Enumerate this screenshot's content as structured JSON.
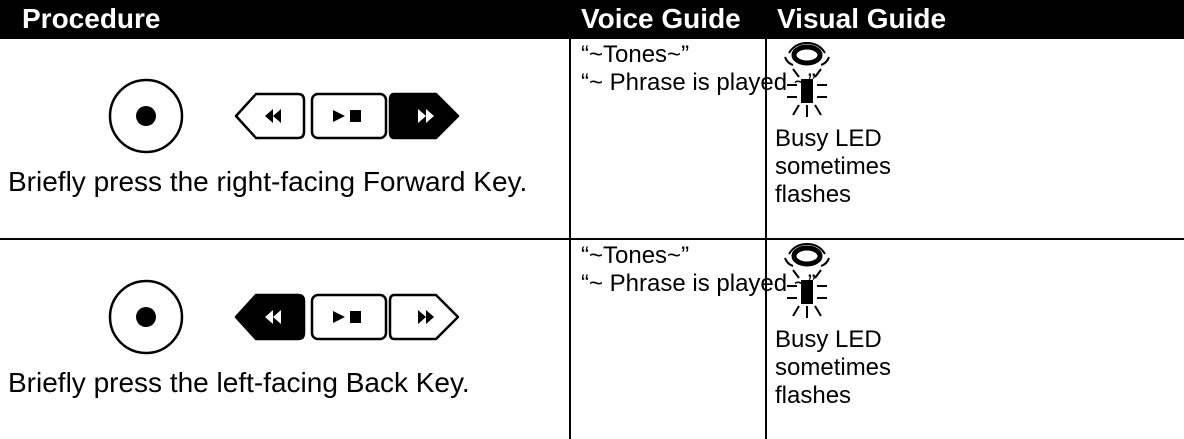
{
  "header": {
    "procedure": "Procedure",
    "voice_guide": "Voice Guide",
    "visual_guide": "Visual Guide"
  },
  "rows": [
    {
      "highlighted_key": "forward",
      "procedure_text": "Briefly press the right-facing Forward Key.",
      "voice_lines": [
        "“~Tones~”",
        "“~ Phrase is played ~”"
      ],
      "visual_icon": "busy-led-icon",
      "visual_lines": [
        "Busy LED",
        "sometimes",
        "flashes"
      ]
    },
    {
      "highlighted_key": "back",
      "procedure_text": "Briefly press the left-facing Back Key.",
      "voice_lines": [
        "“~Tones~”",
        "“~ Phrase is played ~”"
      ],
      "visual_icon": "busy-led-icon",
      "visual_lines": [
        "Busy LED",
        "sometimes",
        "flashes"
      ]
    }
  ],
  "colors": {
    "header_bg": "#000000",
    "header_text": "#ffffff",
    "border": "#000000"
  }
}
